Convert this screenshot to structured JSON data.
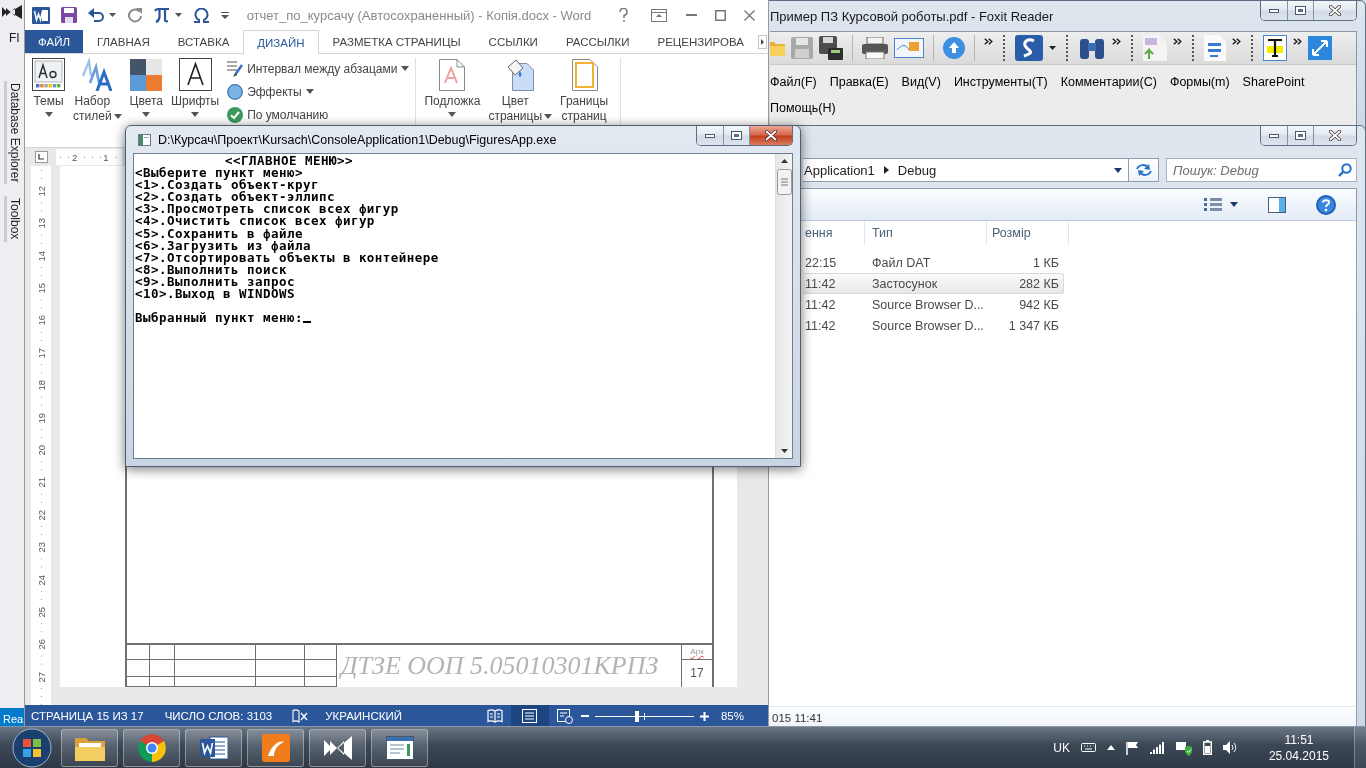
{
  "ide_window": {
    "menu": [
      "FI"
    ],
    "side_tabs": [
      "Database Explorer",
      "Toolbox"
    ],
    "status": "Rea"
  },
  "pdf_reader": {
    "title": "Пример ПЗ Курсовой роботы.pdf - Foxit Reader",
    "active": false,
    "menu": [
      "Файл(F)",
      "Правка(E)",
      "Вид(V)",
      "Инструменты(T)",
      "Комментарии(C)",
      "Формы(m)",
      "SharePoint",
      "Помощь(H)"
    ]
  },
  "file_browser": {
    "active": false,
    "breadcrumb": [
      "Application1",
      "Debug"
    ],
    "search": {
      "placeholder": "Пошук: Debug"
    },
    "columns": [
      "ення",
      "Тип",
      "Розмір"
    ],
    "rows": [
      {
        "modified": "22:15",
        "type": "Файл DAT",
        "size": "1 КБ",
        "selected": false
      },
      {
        "modified": "11:42",
        "type": "Застосунок",
        "size": "282 КБ",
        "selected": true
      },
      {
        "modified": "11:42",
        "type": "Source Browser D...",
        "size": "942 КБ",
        "selected": false
      },
      {
        "modified": "11:42",
        "type": "Source Browser D...",
        "size": "1 347 КБ",
        "selected": false
      }
    ],
    "details": "015 11:41"
  },
  "word": {
    "title": "отчет_по_курсачу (Автосохраненный) - Копія.docx - Word",
    "active": false,
    "tabs": [
      {
        "label": "ФАЙЛ",
        "kind": "file",
        "selected": false
      },
      {
        "label": "ГЛАВНАЯ",
        "kind": "tab",
        "selected": false
      },
      {
        "label": "ВСТАВКА",
        "kind": "tab",
        "selected": false
      },
      {
        "label": "ДИЗАЙН",
        "kind": "tab",
        "selected": true
      },
      {
        "label": "РАЗМЕТКА СТРАНИЦЫ",
        "kind": "tab",
        "selected": false
      },
      {
        "label": "ССЫЛКИ",
        "kind": "tab",
        "selected": false
      },
      {
        "label": "РАССЫЛКИ",
        "kind": "tab",
        "selected": false
      },
      {
        "label": "РЕЦЕНЗИРОВА",
        "kind": "tab",
        "selected": false
      }
    ],
    "ribbon": {
      "groups": [
        {
          "large_buttons": [
            {
              "kind": "themes",
              "label": "Темы",
              "dropdown": true
            },
            {
              "kind": "style_set",
              "label": "Набор стилей",
              "dropdown": true
            },
            {
              "kind": "colors",
              "label": "Цвета",
              "dropdown": true
            },
            {
              "kind": "fonts",
              "label": "Шрифты",
              "dropdown": true
            }
          ],
          "small_buttons": [
            {
              "kind": "spacing",
              "label": "Интервал между абзацами",
              "dropdown": true
            },
            {
              "kind": "effects",
              "label": "Эффекты",
              "dropdown": true
            },
            {
              "kind": "default",
              "label": "По умолчанию",
              "dropdown": false
            }
          ]
        },
        {
          "large_buttons": [
            {
              "kind": "watermark",
              "label": "Подложка",
              "dropdown": true
            },
            {
              "kind": "page_color",
              "label": "Цвет страницы",
              "dropdown": true
            },
            {
              "kind": "page_borders",
              "label": "Границы страниц",
              "dropdown": false
            }
          ]
        }
      ]
    },
    "horizontal_ruler": [
      "2",
      "1"
    ],
    "vertical_ruler": [
      "12",
      "13",
      "14",
      "15",
      "16",
      "17",
      "18",
      "19",
      "20",
      "21",
      "22",
      "23",
      "24",
      "25",
      "26",
      "27"
    ],
    "title_block": {
      "code": "ДТЗЕ ООП 5.05010301КРПЗ",
      "sheet_label": "Арк",
      "sheet_label_misspelled": true,
      "sheet_number": "17"
    },
    "status_bar": {
      "page": "СТРАНИЦА 15 ИЗ 17",
      "words": "ЧИСЛО СЛОВ: 3103",
      "language": "УКРАИНСКИЙ",
      "views": [
        {
          "kind": "read",
          "selected": false
        },
        {
          "kind": "print",
          "selected": true
        },
        {
          "kind": "web",
          "selected": false
        }
      ],
      "zoom": {
        "level": 0.42,
        "reading": "85%"
      }
    }
  },
  "console": {
    "title": "D:\\Курсач\\Проект\\Kursach\\ConsoleApplication1\\Debug\\FiguresApp.exe",
    "active": true,
    "lines": [
      {
        "kind": "heading",
        "text": "<<ГЛАВНОЕ МЕНЮ>>"
      },
      {
        "kind": "line",
        "text": "<Выберите пункт меню>"
      },
      {
        "kind": "line",
        "text": "<1>.Создать объект-круг"
      },
      {
        "kind": "line",
        "text": "<2>.Создать объект-эллипс"
      },
      {
        "kind": "line",
        "text": "<3>.Просмотреть список всех фигур"
      },
      {
        "kind": "line",
        "text": "<4>.Очистить список всех фигур"
      },
      {
        "kind": "line",
        "text": "<5>.Сохранить в файле"
      },
      {
        "kind": "line",
        "text": "<6>.Загрузить из файла"
      },
      {
        "kind": "line",
        "text": "<7>.Отсортировать объекты в контейнере"
      },
      {
        "kind": "line",
        "text": "<8>.Выполнить поиск"
      },
      {
        "kind": "line",
        "text": "<9>.Выполнить запрос"
      },
      {
        "kind": "line",
        "text": "<10>.Выход в WINDOWS"
      },
      {
        "kind": "prompt",
        "text": "Выбранный пункт меню:"
      }
    ]
  },
  "taskbar": {
    "language": "UK",
    "time": "11:51",
    "date": "25.04.2015"
  }
}
